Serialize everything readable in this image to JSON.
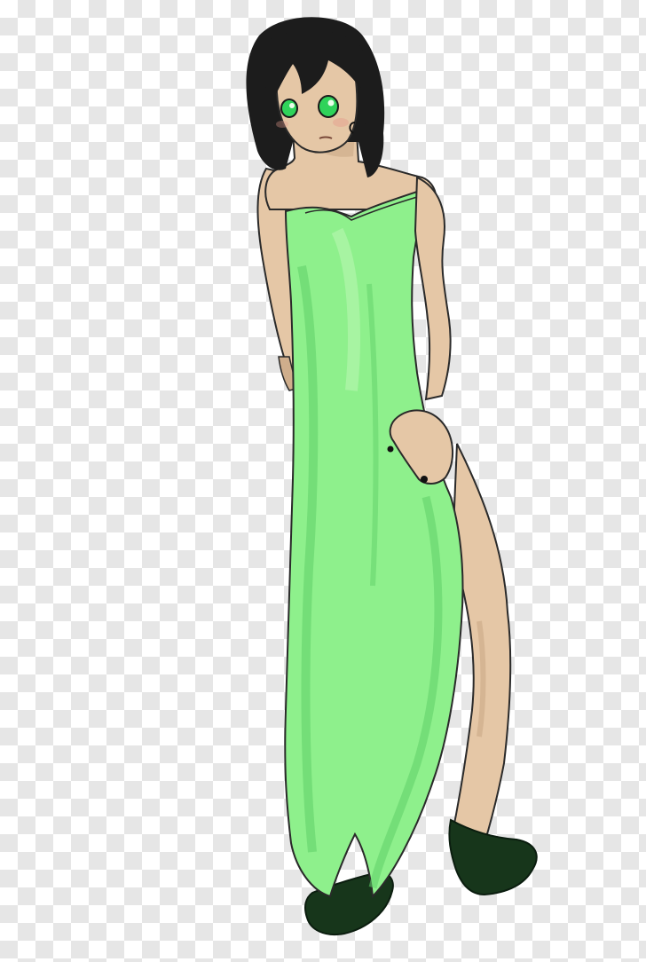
{
  "image": {
    "subject": "illustration",
    "background": "transparency-checkerboard"
  },
  "colors": {
    "checker_light": "#ffffff",
    "checker_dark": "#e6e6e6",
    "hair": "#1c1c1c",
    "skin": "#e5c7a6",
    "skin_shadow": "#cfae8c",
    "dress": "#8ef08c",
    "dress_shadow": "#5fcf67",
    "dress_highlight": "#b7f7b0",
    "eyes": "#2fd35a",
    "shoes": "#17361b",
    "outline": "#2a2a2a"
  }
}
